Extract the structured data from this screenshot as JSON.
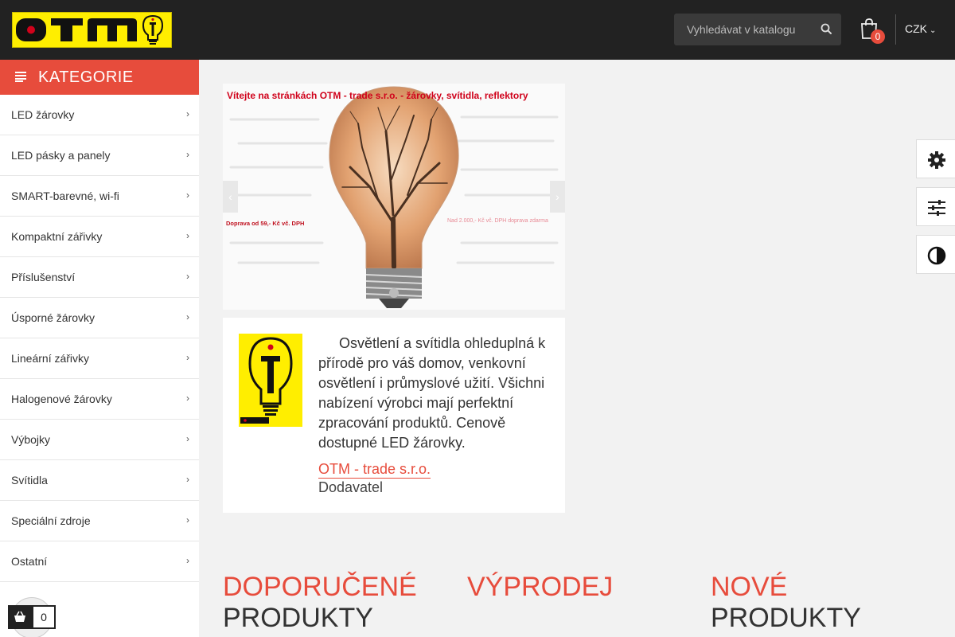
{
  "header": {
    "logo_text": "OTM",
    "search_placeholder": "Vyhledávat v katalogu",
    "cart_count": "0",
    "currency": "CZK"
  },
  "sidebar": {
    "title": "KATEGORIE",
    "items": [
      {
        "label": "LED žárovky"
      },
      {
        "label": "LED pásky a panely"
      },
      {
        "label": "SMART-barevné, wi-fi"
      },
      {
        "label": "Kompaktní zářivky"
      },
      {
        "label": "Příslušenství"
      },
      {
        "label": "Úsporné žárovky"
      },
      {
        "label": "Lineární zářivky"
      },
      {
        "label": "Halogenové žárovky"
      },
      {
        "label": "Výbojky"
      },
      {
        "label": "Svítidla"
      },
      {
        "label": "Speciální zdroje"
      },
      {
        "label": "Ostatní"
      }
    ]
  },
  "slider": {
    "title": "Vítejte na stránkách OTM - trade s.r.o. - žárovky, svítidla, reflektory",
    "left_note": "Doprava od 59,- Kč vč. DPH",
    "right_note": "Nad 2.000,- Kč vč. DPH doprava zdarma"
  },
  "about": {
    "logo_text": "OTM",
    "text": "Osvětlení a svítidla ohleduplná k přírodě pro váš domov, venkovní osvětlení i průmyslové užití. Všichni nabízení výrobci mají perfektní zpracování produktů. Cenově dostupné LED žárovky.",
    "company_link": "OTM - trade s.r.o.",
    "company_role": "Dodavatel"
  },
  "sections": [
    {
      "line1": "DOPORUČENÉ",
      "line2": "PRODUKTY"
    },
    {
      "line1": "VÝPRODEJ",
      "line2": ""
    },
    {
      "line1": "NOVÉ",
      "line2": "PRODUKTY"
    }
  ],
  "mini_cart": {
    "count": "0"
  },
  "colors": {
    "accent": "#e74c3c",
    "header_bg": "#222222",
    "logo_bg": "#ffee00"
  }
}
